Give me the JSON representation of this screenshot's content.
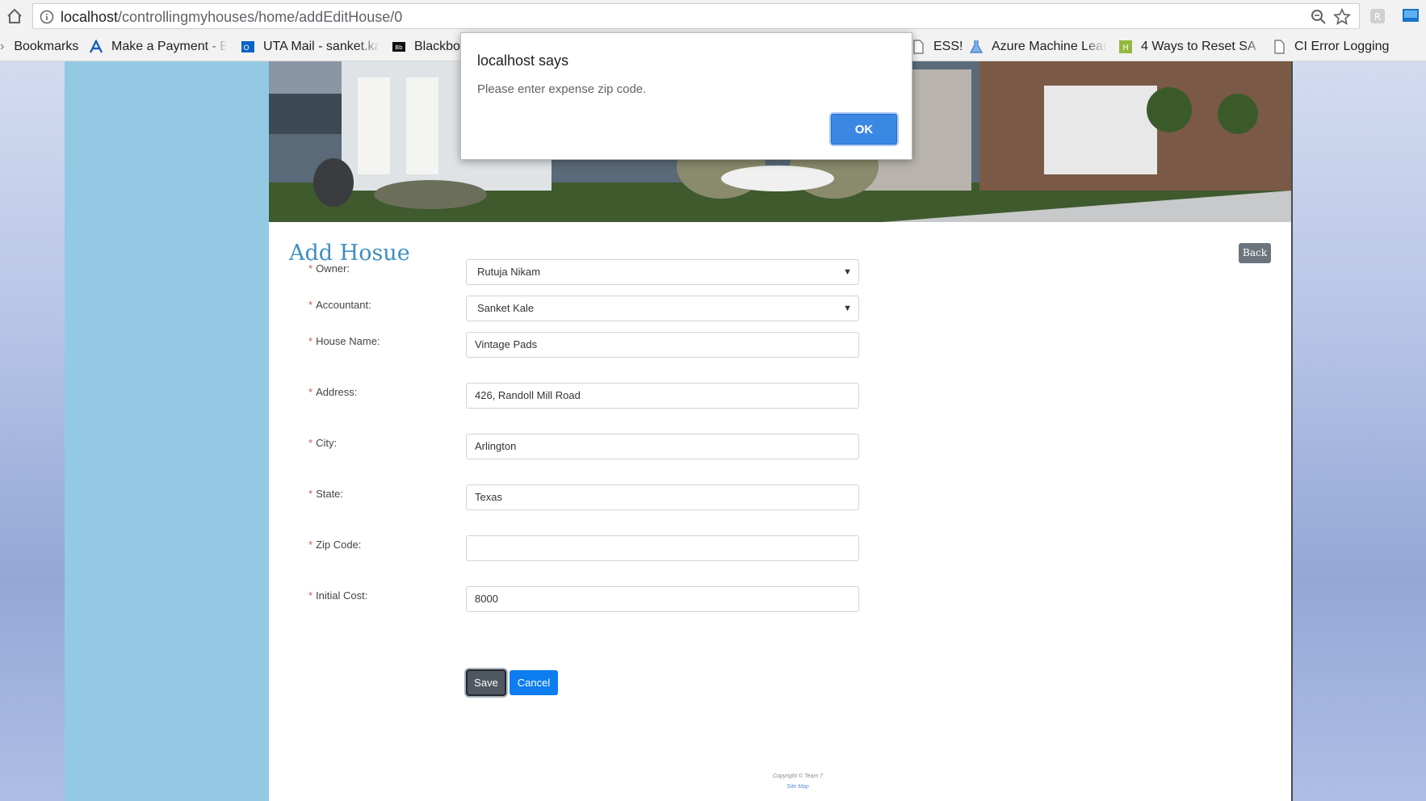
{
  "browser": {
    "url_host": "localhost",
    "url_path": "/controllingmyhouses/home/addEditHouse/0",
    "bookmarks": [
      {
        "label": "Bookmarks",
        "icon": "folder-icon"
      },
      {
        "label": "Make a Payment - B",
        "icon": "payment-site-icon"
      },
      {
        "label": "UTA Mail - sanket.ka",
        "icon": "outlook-icon"
      },
      {
        "label": "Blackbo",
        "icon": "blackboard-icon"
      },
      {
        "label": "ESS!",
        "icon": "page-icon"
      },
      {
        "label": "Azure Machine Lear",
        "icon": "flask-icon"
      },
      {
        "label": "4 Ways to Reset SA P",
        "icon": "wikihow-icon"
      },
      {
        "label": "CI Error Logging",
        "icon": "page-icon"
      }
    ]
  },
  "dialog": {
    "title": "localhost says",
    "message": "Please enter expense zip code.",
    "ok_label": "OK"
  },
  "page": {
    "title": "Add Hosue",
    "back_label": "Back",
    "required_marker": "*",
    "fields": {
      "owner": {
        "label": "Owner:",
        "value": "Rutuja Nikam"
      },
      "accountant": {
        "label": "Accountant:",
        "value": "Sanket Kale"
      },
      "house_name": {
        "label": "House Name:",
        "value": "Vintage Pads"
      },
      "address": {
        "label": "Address:",
        "value": "426, Randoll Mill Road"
      },
      "city": {
        "label": "City:",
        "value": "Arlington"
      },
      "state": {
        "label": "State:",
        "value": "Texas"
      },
      "zip_code": {
        "label": "Zip Code:",
        "value": ""
      },
      "initial_cost": {
        "label": "Initial Cost:",
        "value": "8000"
      }
    },
    "save_label": "Save",
    "cancel_label": "Cancel",
    "footer": {
      "copyright": "Copyright © Team 7",
      "sitemap": "Site Map"
    }
  },
  "colors": {
    "title_blue": "#3f8ec0",
    "sidebar_blue": "#94c9e3",
    "save_gray": "#4f5760",
    "cancel_blue": "#0d7df0",
    "ok_blue": "#3b87e4"
  }
}
